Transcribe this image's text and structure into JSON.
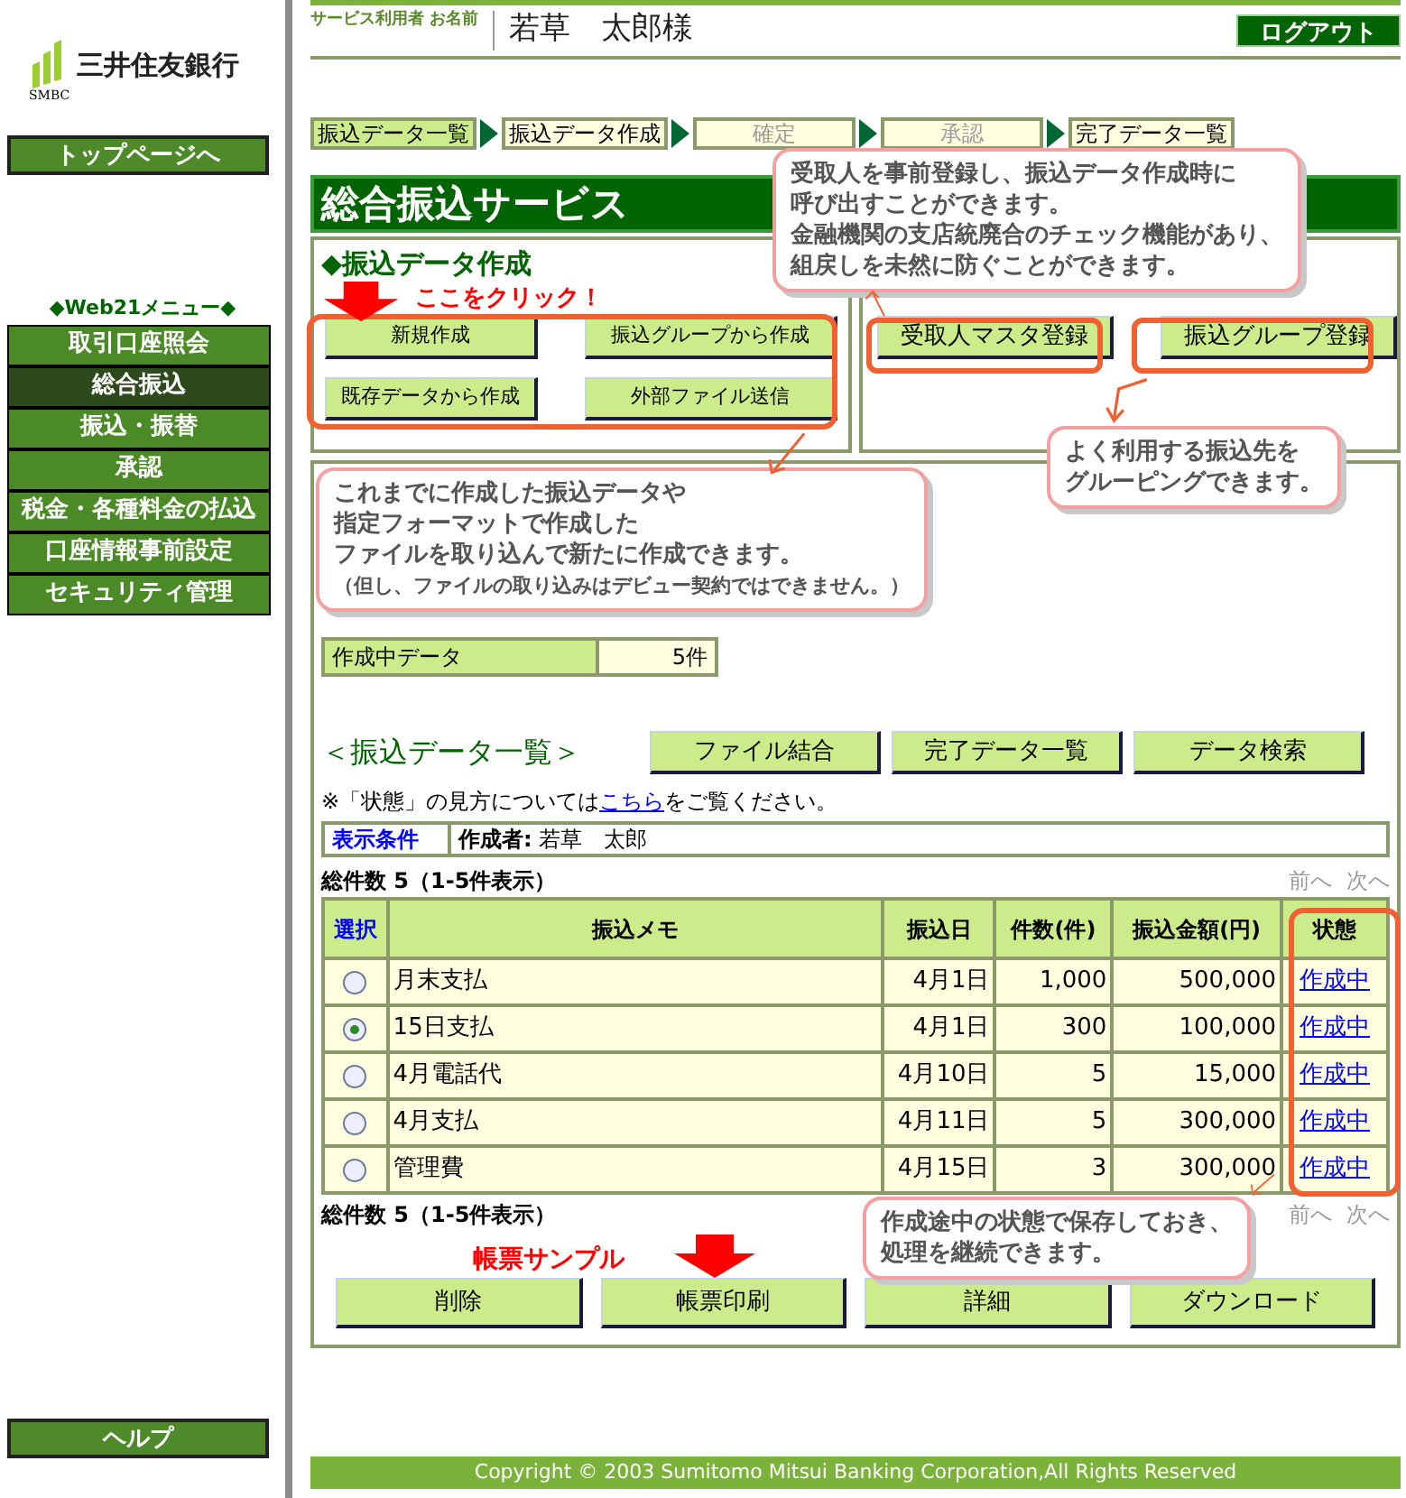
{
  "sidebar": {
    "logo_text": "三井住友銀行",
    "logo_sub": "SMBC",
    "top_button": "トップページへ",
    "menu_title": "◆Web21メニュー◆",
    "menu": [
      {
        "label": "取引口座照会",
        "selected": false
      },
      {
        "label": "総合振込",
        "selected": true
      },
      {
        "label": "振込・振替",
        "selected": false
      },
      {
        "label": "承認",
        "selected": false
      },
      {
        "label": "税金・各種料金の払込",
        "selected": false
      },
      {
        "label": "口座情報事前設定",
        "selected": false
      },
      {
        "label": "セキュリティ管理",
        "selected": false
      }
    ],
    "help_button": "ヘルプ"
  },
  "header": {
    "user_label": "サービス利用者 お名前",
    "user_name": "若草　太郎様",
    "logout": "ログアウト"
  },
  "steps": [
    {
      "label": "振込データ一覧",
      "completed": true,
      "disabled": false
    },
    {
      "label": "振込データ作成",
      "completed": false,
      "disabled": false
    },
    {
      "label": "確定",
      "completed": false,
      "disabled": true
    },
    {
      "label": "承認",
      "completed": false,
      "disabled": true
    },
    {
      "label": "完了データ一覧",
      "completed": false,
      "disabled": false
    }
  ],
  "title": "総合振込サービス",
  "create_section": {
    "heading": "◆振込データ作成",
    "buttons": [
      "新規作成",
      "振込グループから作成",
      "既存データから作成",
      "外部ファイル送信"
    ],
    "register_buttons": [
      "受取人マスタ登録",
      "振込グループ登録"
    ]
  },
  "summary_rows": [
    {
      "label": "作成中データ",
      "value": "5件"
    }
  ],
  "list_section": {
    "heading": "＜振込データ一覧＞",
    "buttons": [
      "ファイル結合",
      "完了データ一覧",
      "データ検索"
    ],
    "note_before": "※「状態」の見方については",
    "note_link": "こちら",
    "note_after": "をご覧ください。",
    "condition_label": "表示条件",
    "condition_value": "**作成者:** 若草　太郎",
    "total_top": "総件数 5（1-5件表示）",
    "total_bottom": "総件数 5（1-5件表示）",
    "pager_top": [
      {
        "label": "前へ",
        "disabled": true
      },
      {
        "label": "次へ",
        "disabled": true
      }
    ],
    "pager_bottom": [
      {
        "label": "前へ",
        "disabled": true
      },
      {
        "label": "次へ",
        "disabled": true
      }
    ]
  },
  "table": {
    "columns": [
      "選択",
      "振込メモ",
      "振込日",
      "件数(件)",
      "振込金額(円)",
      "状態"
    ],
    "rows": [
      {
        "selected": false,
        "memo": "月末支払",
        "date": "4月1日",
        "count": "1,000",
        "amount": "500,000",
        "status": "作成中"
      },
      {
        "selected": true,
        "memo": "15日支払",
        "date": "4月1日",
        "count": "300",
        "amount": "100,000",
        "status": "作成中"
      },
      {
        "selected": false,
        "memo": "4月電話代",
        "date": "4月10日",
        "count": "5",
        "amount": "15,000",
        "status": "作成中"
      },
      {
        "selected": false,
        "memo": "4月支払",
        "date": "4月11日",
        "count": "5",
        "amount": "300,000",
        "status": "作成中"
      },
      {
        "selected": false,
        "memo": "管理費",
        "date": "4月15日",
        "count": "3",
        "amount": "300,000",
        "status": "作成中"
      }
    ]
  },
  "action_buttons": [
    "削除",
    "帳票印刷",
    "詳細",
    "ダウンロード"
  ],
  "footer": "Copyright © 2003 Sumitomo Mitsui Banking Corporation,All Rights Reserved",
  "annotations": {
    "click_here": "ここをクリック！",
    "sample": "帳票サンプル",
    "callout_register": [
      "受取人を事前登録し、振込データ作成時に",
      "呼び出すことができます。",
      "金融機関の支店統廃合のチェック機能があり、",
      "組戻しを未然に防ぐことができます。"
    ],
    "callout_group": [
      "よく利用する振込先を",
      "グルーピングできます。"
    ],
    "callout_import": [
      "これまでに作成した振込データや",
      "指定フォーマットで作成した",
      "ファイルを取り込んで新たに作成できます。"
    ],
    "callout_import_note": "（但し、ファイルの取り込みはデビュー契約ではできません。）",
    "callout_status": [
      "作成途中の状態で保存しておき、",
      "処理を継続できます。"
    ]
  }
}
